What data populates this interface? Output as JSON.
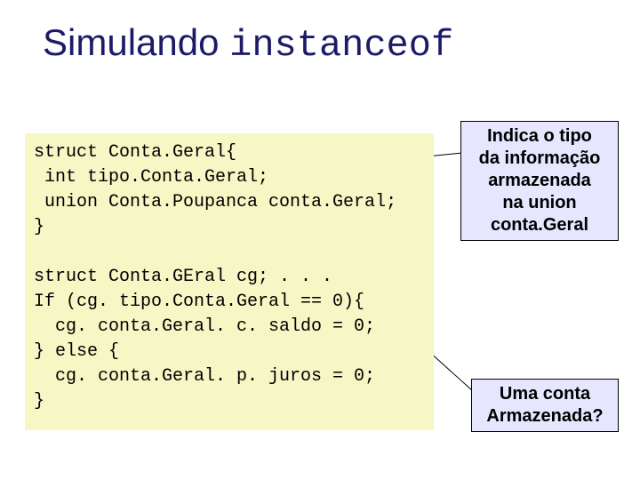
{
  "title": {
    "prefix": "Simulando ",
    "keyword": "instanceof"
  },
  "code": {
    "lines": [
      "struct Conta.Geral{",
      " int tipo.Conta.Geral;",
      " union Conta.Poupanca conta.Geral;",
      "}",
      "",
      "struct Conta.GEral cg; . . .",
      "If (cg. tipo.Conta.Geral == 0){",
      "  cg. conta.Geral. c. saldo = 0;",
      "} else {",
      "  cg. conta.Geral. p. juros = 0;",
      "}"
    ]
  },
  "callouts": {
    "c1": {
      "l1": "Indica o tipo",
      "l2": "da informação",
      "l3": "armazenada",
      "l4": "na union",
      "l5": "conta.Geral"
    },
    "c2": {
      "l1": "Uma conta",
      "l2": "Armazenada?"
    }
  }
}
